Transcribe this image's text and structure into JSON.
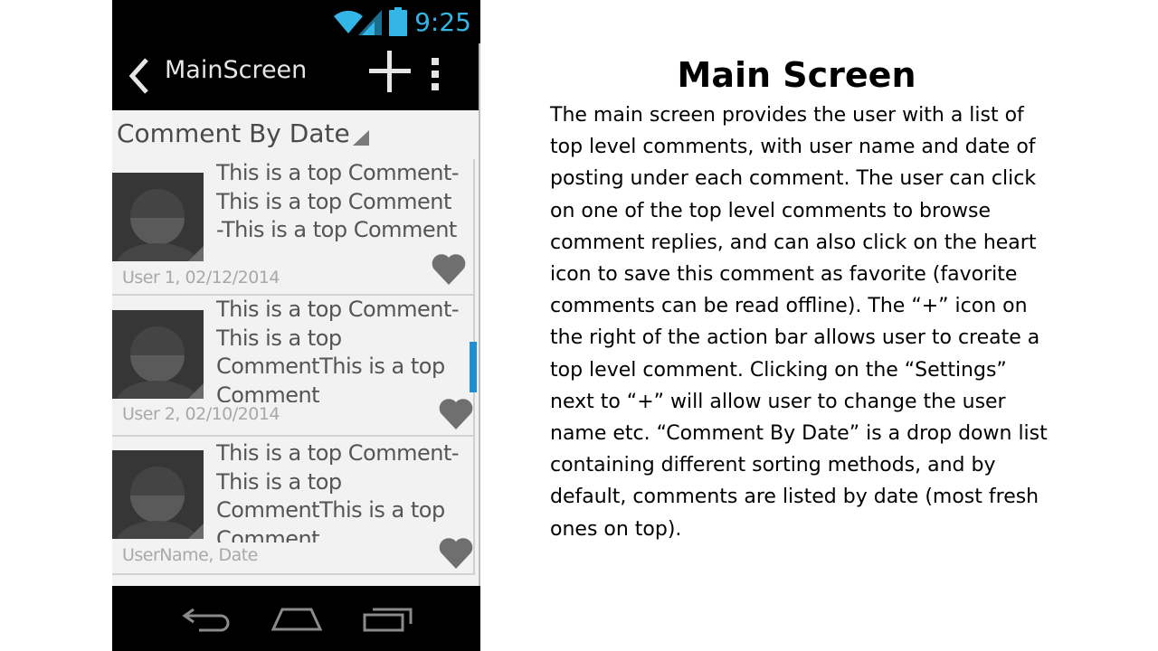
{
  "status_bar": {
    "time": "9:25",
    "time_color": "#33b5e5",
    "icons": [
      "wifi-icon",
      "signal-icon",
      "battery-icon"
    ]
  },
  "action_bar": {
    "title": "MainScreen",
    "icons": [
      "back-chevron-icon",
      "plus-icon",
      "overflow-menu-icon"
    ]
  },
  "sort": {
    "selected": "Comment By Date"
  },
  "comments": [
    {
      "text": "This is a top Comment- This is a top Comment -This is a top Comment",
      "meta": "User 1, 02/12/2014"
    },
    {
      "text": "This is a top Comment-This is a top CommentThis is a top Comment",
      "meta": "User 2, 02/10/2014"
    },
    {
      "text": "This is a top Comment-This is a top CommentThis is a top Comment",
      "meta": "UserName, Date"
    }
  ],
  "nav_bar": {
    "icons": [
      "back-icon",
      "home-icon",
      "recent-apps-icon"
    ]
  },
  "description": {
    "title": "Main Screen",
    "body": "The main screen provides the user with a list of top level comments, with user name and date of posting under each comment. The user can click on one of the top level comments to browse comment replies, and can also click on the heart icon to save this comment as favorite (favorite comments can be read offline). The “+” icon on the right of the action bar allows user to create a top level comment. Clicking on the “Settings” next to “+” will allow user to change the user name etc. “Comment By Date” is a drop down list containing different sorting methods, and by default, comments are listed by date (most fresh ones on top)."
  },
  "colors": {
    "accent": "#33b5e5",
    "scroll_thumb": "#1e8fd0",
    "avatar_bg": "#363636",
    "heart": "#6f6f6f"
  }
}
